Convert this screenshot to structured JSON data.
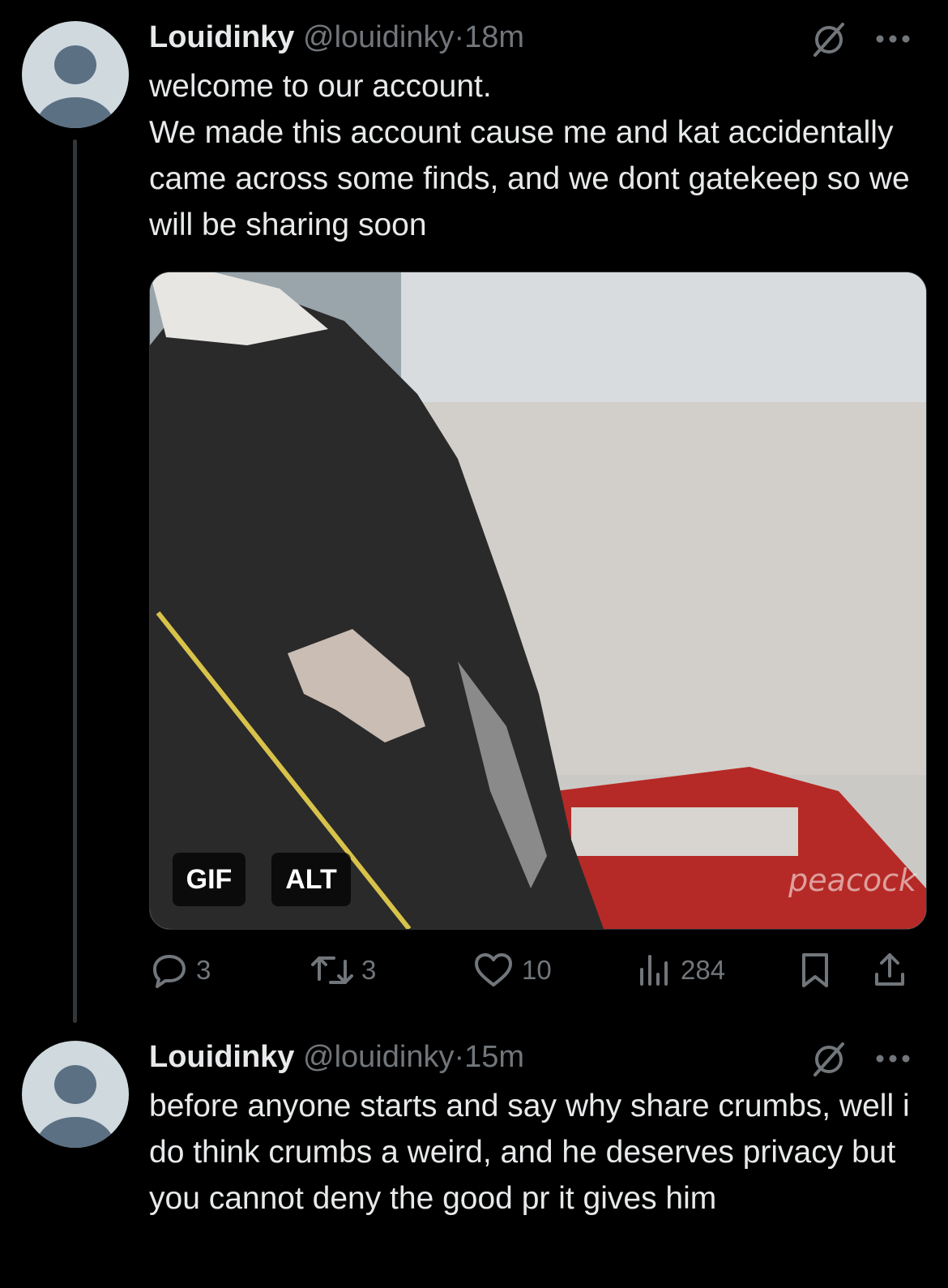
{
  "posts": [
    {
      "author_name": "Louidinky",
      "handle": "@louidinky",
      "separator": "·",
      "time": "18m",
      "text": "welcome to our account.\nWe made this account cause me and kat accidentally came across some finds, and we dont gatekeep so we will be sharing soon",
      "media": {
        "gif_label": "GIF",
        "alt_label": "ALT",
        "watermark": "peacock"
      },
      "actions": {
        "replies": "3",
        "reposts": "3",
        "likes": "10",
        "views": "284"
      }
    },
    {
      "author_name": "Louidinky",
      "handle": "@louidinky",
      "separator": "·",
      "time": "15m",
      "text": "before anyone starts and say why share crumbs, well i do think crumbs a weird, and he deserves privacy but you cannot deny the good pr it gives him"
    }
  ],
  "colors": {
    "background": "#000000",
    "text": "#e7e9ea",
    "muted": "#71767b",
    "avatar_bg": "#cfd9de",
    "avatar_fg": "#5b7083"
  },
  "icons": [
    "default-avatar-icon",
    "muted-conversation-icon",
    "more-icon",
    "reply-icon",
    "repost-icon",
    "like-icon",
    "views-icon",
    "bookmark-icon",
    "share-icon"
  ]
}
